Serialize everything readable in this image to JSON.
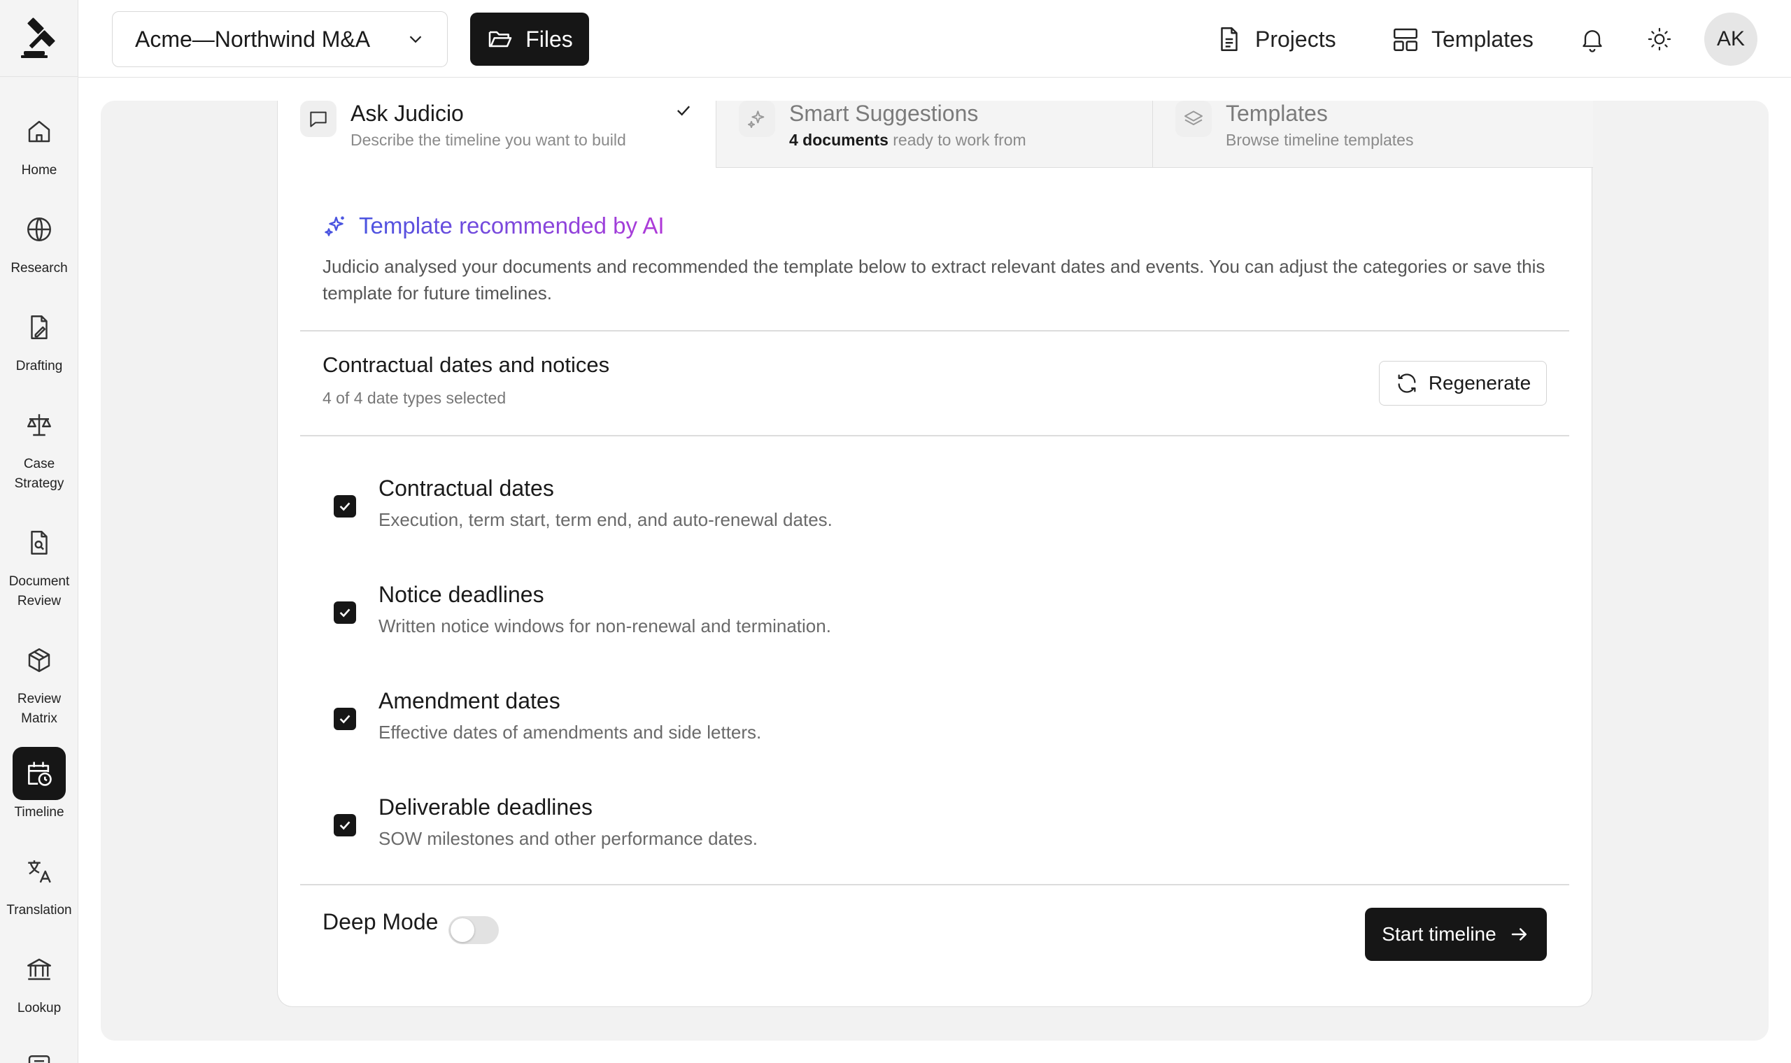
{
  "app": {
    "colors": {
      "accent": "#161616",
      "ai_gradient_start": "#4a54e0",
      "ai_gradient_end": "#b03ad8",
      "background": "#f2f2f2"
    }
  },
  "sidebar": {
    "logo_icon": "gavel-icon",
    "items": [
      {
        "label": "Home",
        "icon": "home-icon",
        "active": false
      },
      {
        "label": "Research",
        "icon": "globe-icon",
        "active": false
      },
      {
        "label": "Drafting",
        "icon": "document-pen-icon",
        "active": false
      },
      {
        "label_line1": "Case",
        "label_line2": "Strategy",
        "icon": "scales-icon",
        "active": false
      },
      {
        "label_line1": "Document",
        "label_line2": "Review",
        "icon": "document-search-icon",
        "active": false
      },
      {
        "label_line1": "Review",
        "label_line2": "Matrix",
        "icon": "cube-icon",
        "active": false
      },
      {
        "label": "Timeline",
        "icon": "calendar-clock-icon",
        "active": true
      },
      {
        "label": "Translation",
        "icon": "translate-icon",
        "active": false
      },
      {
        "label": "Lookup",
        "icon": "bank-icon",
        "active": false
      }
    ]
  },
  "topbar": {
    "project_name": "Acme—Northwind M&A",
    "files_label": "Files",
    "projects_label": "Projects",
    "templates_label": "Templates",
    "avatar_initials": "AK"
  },
  "tabs": [
    {
      "title": "Ask Judicio",
      "subtitle": "Describe the timeline you want to build",
      "active": true
    },
    {
      "title": "Smart Suggestions",
      "subtitle_bold": "4 documents",
      "subtitle_rest": " ready to work from",
      "active": false
    },
    {
      "title": "Templates",
      "subtitle": "Browse timeline templates",
      "active": false
    }
  ],
  "recommendation": {
    "title": "Template recommended by AI",
    "description": "Judicio analysed your documents and recommended the template below to extract relevant dates and events. You can adjust the categories or save this template for future timelines."
  },
  "template": {
    "name": "Contractual dates and notices",
    "selection_count": "4 of 4 date types selected",
    "regenerate_label": "Regenerate"
  },
  "options": [
    {
      "title": "Contractual dates",
      "description": "Execution, term start, term end, and auto-renewal dates.",
      "checked": true
    },
    {
      "title": "Notice deadlines",
      "description": "Written notice windows for non-renewal and termination.",
      "checked": true
    },
    {
      "title": "Amendment dates",
      "description": "Effective dates of amendments and side letters.",
      "checked": true
    },
    {
      "title": "Deliverable deadlines",
      "description": "SOW milestones and other performance dates.",
      "checked": true
    }
  ],
  "footer": {
    "deep_mode_label": "Deep Mode",
    "deep_mode_on": false,
    "start_label": "Start timeline"
  }
}
